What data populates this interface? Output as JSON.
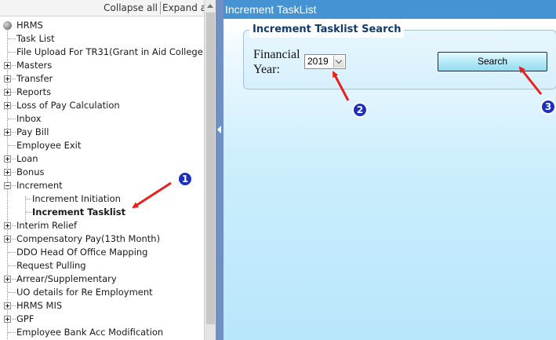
{
  "toolbar": {
    "collapse_all": "Collapse all",
    "expand_all": "Expand a"
  },
  "tree": {
    "root": "HRMS",
    "task_list": "Task List",
    "file_upload": "File Upload For TR31(Grant in Aid College",
    "masters": "Masters",
    "transfer": "Transfer",
    "reports": "Reports",
    "loss_of_pay": "Loss of Pay Calculation",
    "inbox": "Inbox",
    "pay_bill": "Pay Bill",
    "employee_exit": "Employee Exit",
    "loan": "Loan",
    "bonus": "Bonus",
    "increment": "Increment",
    "increment_initiation": "Increment Initiation",
    "increment_tasklist": "Increment Tasklist",
    "interim_relief": "Interim Relief",
    "compensatory_pay": "Compensatory Pay(13th Month)",
    "ddo_head": "DDO Head Of Office Mapping",
    "request_pulling": "Request Pulling",
    "arrear": "Arrear/Supplementary",
    "uo_details": "UO details for Re Employment",
    "hrms_mis": "HRMS MIS",
    "gpf": "GPF",
    "employee_bank": "Employee Bank Acc Modification"
  },
  "header": {
    "title": "Increment TaskList"
  },
  "search_panel": {
    "legend": "Increment Tasklist Search",
    "financial_year_label": "Financial Year:",
    "year_value": "2019",
    "search_label": "Search"
  },
  "annotations": {
    "badge_1": "1",
    "badge_2": "2",
    "badge_3": "3",
    "arrow_color": "#e8211d",
    "badge_color": "#1d2fbf"
  }
}
